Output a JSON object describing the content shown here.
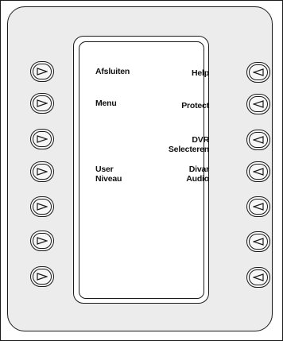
{
  "left_labels": [
    {
      "row": 0,
      "text": "Afsluiten"
    },
    {
      "row": 1,
      "text": "Menu"
    },
    {
      "row": 3,
      "line1": "User",
      "line2": "Niveau"
    }
  ],
  "right_labels": [
    {
      "row": 0,
      "text": "Help"
    },
    {
      "row": 1,
      "text": "Protect"
    },
    {
      "row": 2,
      "line1": "DVR",
      "line2": "Selecteren"
    },
    {
      "row": 3,
      "line1": "Divar",
      "line2": "Audio"
    }
  ],
  "buttons": {
    "left_count": 7,
    "right_count": 7,
    "left_icon": "triangle-right-icon",
    "right_icon": "triangle-left-icon"
  }
}
